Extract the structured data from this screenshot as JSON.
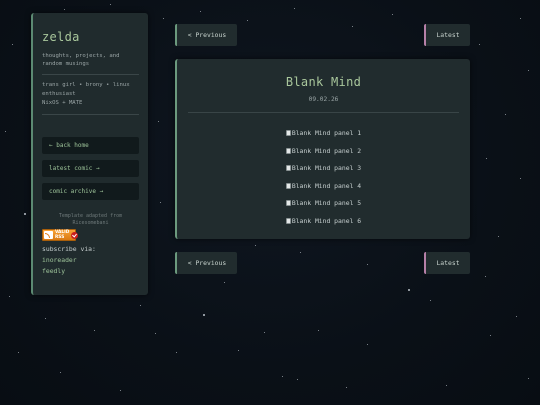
{
  "sidebar": {
    "title": "zelda",
    "tagline": "thoughts, projects, and random musings",
    "about_line1": "trans girl • brony • linux enthusiast",
    "about_line2": "NixOS + MATE",
    "nav": {
      "back_home": "← back home",
      "latest_comic": "latest comic →",
      "comic_archive": "comic archive →"
    },
    "credit": "Template adapted from Ricesomebani",
    "rss_badge_text": "VALID RSS",
    "subscribe_label": "subscribe via:",
    "subscribe_links": [
      "inoreader",
      "feedly"
    ]
  },
  "pagination": {
    "previous": "< Previous",
    "latest": "Latest"
  },
  "comic": {
    "title": "Blank Mind",
    "date": "09.02.26",
    "panels": [
      "Blank Mind panel 1",
      "Blank Mind panel 2",
      "Blank Mind panel 3",
      "Blank Mind panel 4",
      "Blank Mind panel 5",
      "Blank Mind panel 6"
    ]
  },
  "colors": {
    "background": "#0b1119",
    "card": "#212c2e",
    "accent_green": "#a9c79c",
    "border_green": "#6c9a7e",
    "border_pink": "#b680a8"
  }
}
